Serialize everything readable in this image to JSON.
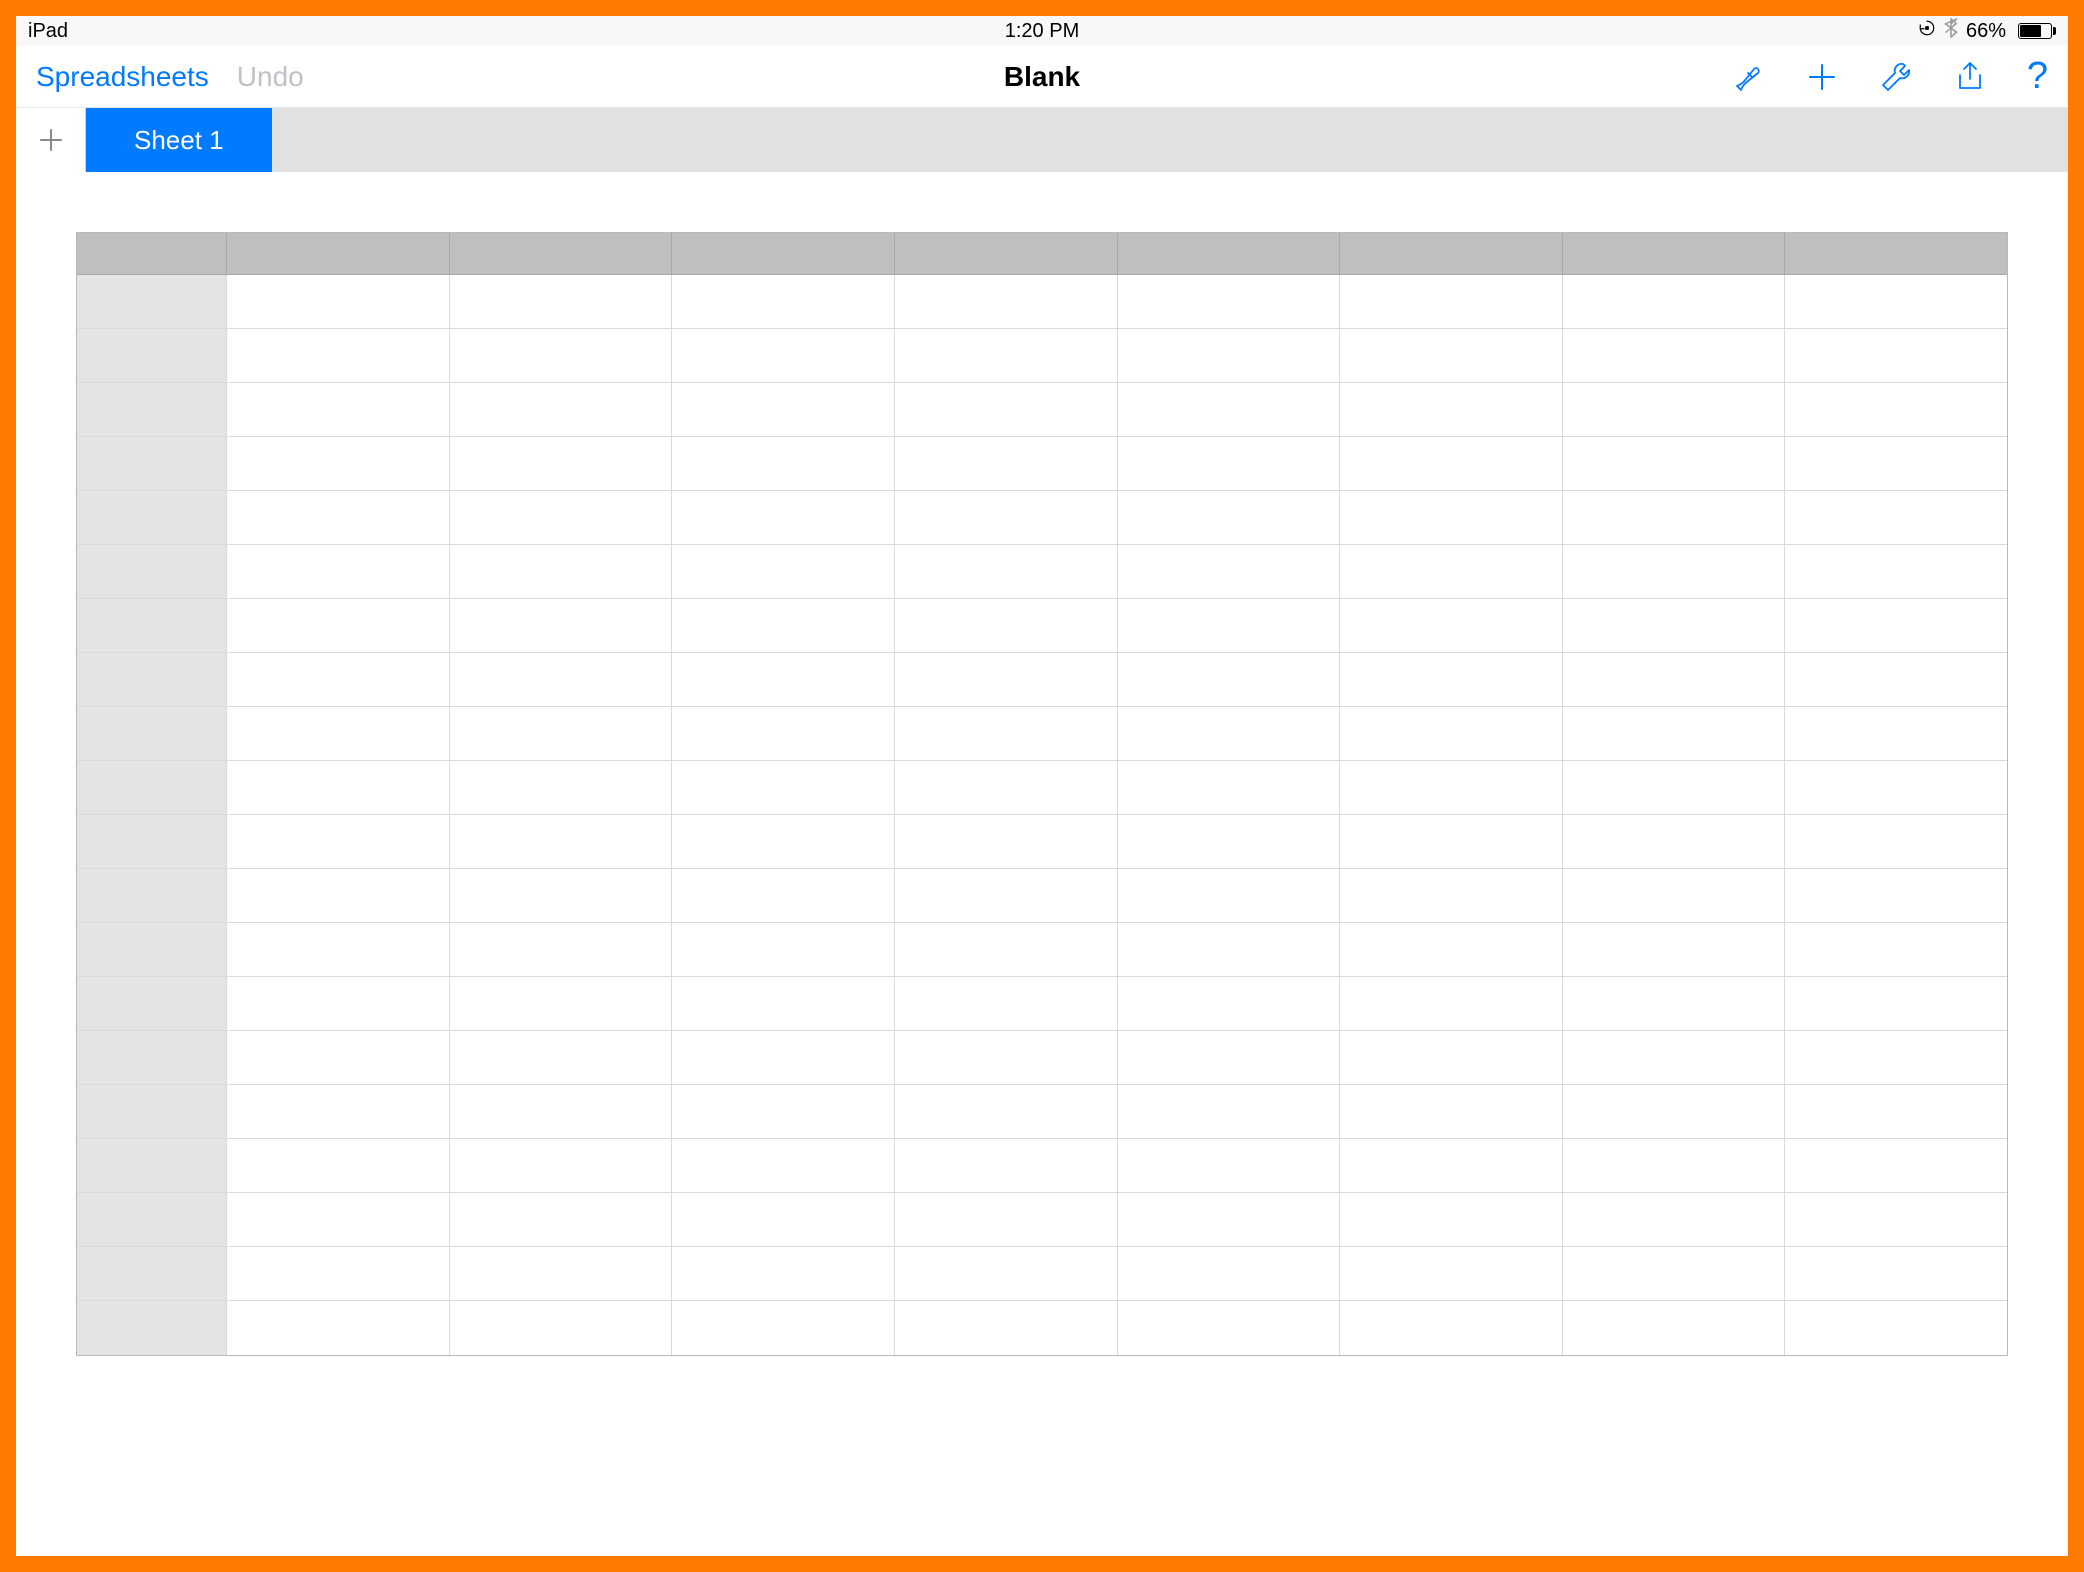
{
  "statusbar": {
    "device": "iPad",
    "time": "1:20 PM",
    "battery_text": "66%",
    "battery_fill_pct": 66
  },
  "toolbar": {
    "back_label": "Spreadsheets",
    "undo_label": "Undo",
    "title": "Blank",
    "help_label": "?"
  },
  "tabs": {
    "active": "Sheet 1"
  },
  "grid": {
    "columns": 8,
    "rows": 20
  },
  "colors": {
    "accent": "#007aff",
    "frame": "#ff7a00"
  }
}
